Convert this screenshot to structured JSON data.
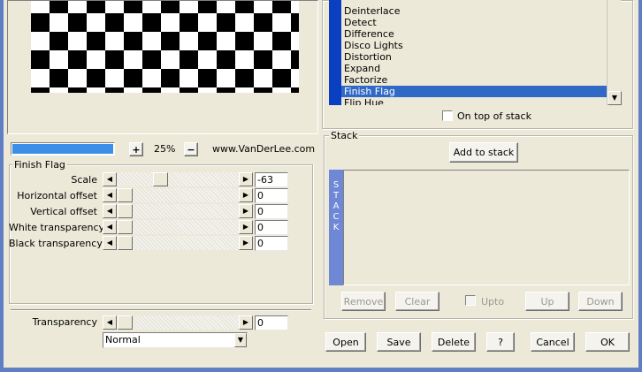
{
  "preview": {
    "zoom_value": "25%",
    "zoom_plus": "+",
    "zoom_minus": "−",
    "website": "www.VanDerLee.com"
  },
  "finish_flag_group": {
    "title": "Finish Flag",
    "params": [
      {
        "label": "Scale",
        "value": "-63"
      },
      {
        "label": "Horizontal offset",
        "value": "0"
      },
      {
        "label": "Vertical offset",
        "value": "0"
      },
      {
        "label": "White transparency",
        "value": "0"
      },
      {
        "label": "Black transparency",
        "value": "0"
      }
    ]
  },
  "transparency": {
    "label": "Transparency",
    "value": "0",
    "blend_mode": "Normal"
  },
  "filter_list": {
    "items": [
      "Deinterlace",
      "Detect",
      "Difference",
      "Disco Lights",
      "Distortion",
      "Expand",
      "Factorize",
      "Finish Flag",
      "Flip Hue"
    ],
    "selected": "Finish Flag",
    "on_top_label": "On top of stack"
  },
  "stack": {
    "title": "Stack",
    "add_button": "Add to stack",
    "side_label": [
      "S",
      "T",
      "A",
      "C",
      "K"
    ],
    "remove": "Remove",
    "clear": "Clear",
    "upto": "Upto",
    "up": "Up",
    "down": "Down"
  },
  "actions": {
    "open": "Open",
    "save": "Save",
    "delete": "Delete",
    "help": "?",
    "cancel": "Cancel",
    "ok": "OK"
  },
  "colors": {
    "selection": "#3169c6",
    "progress": "#3d8ee6",
    "stack_sidebar": "#6f88d6"
  }
}
